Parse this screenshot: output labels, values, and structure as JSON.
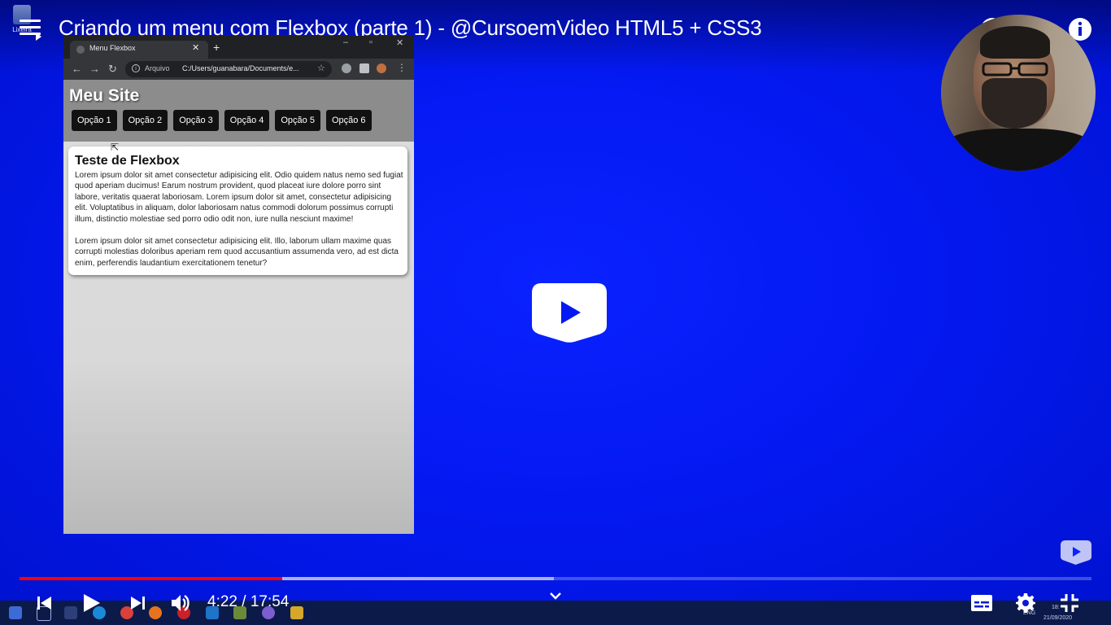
{
  "video": {
    "title": "Criando um menu com Flexbox (parte 1) - @CursoemVideo HTML5 + CSS3",
    "current_time": "4:22",
    "separator": " / ",
    "duration": "17:54",
    "played_fraction": 0.2447,
    "buffered_fraction": 0.4985
  },
  "desktop": {
    "recycle_bin_label": "Lixeira"
  },
  "browser": {
    "tab_title": "Menu Flexbox",
    "url_label": "Arquivo",
    "url": "C:/Users/guanabara/Documents/e..."
  },
  "site": {
    "title": "Meu Site",
    "menu": [
      "Opção 1",
      "Opção 2",
      "Opção 3",
      "Opção 4",
      "Opção 5",
      "Opção 6"
    ],
    "card": {
      "heading": "Teste de Flexbox",
      "p1": "Lorem ipsum dolor sit amet consectetur adipisicing elit. Odio quidem natus nemo sed fugiat quod aperiam ducimus! Earum nostrum provident, quod placeat iure dolore porro sint labore, veritatis quaerat laboriosam. Lorem ipsum dolor sit amet, consectetur adipisicing elit. Voluptatibus in aliquam, dolor laboriosam natus commodi dolorum possimus corrupti illum, distinctio molestiae sed porro odio odit non, iure nulla nesciunt maxime!",
      "p2": "Lorem ipsum dolor sit amet consectetur adipisicing elit. Illo, laborum ullam maxime quas corrupti molestias doloribus aperiam rem quod accusantium assumenda vero, ad est dicta enim, perferendis laudantium exercitationem tenetur?"
    }
  },
  "taskbar": {
    "date": "21/09/2020",
    "time_partial": "18:",
    "lang": "ENG"
  },
  "colors": {
    "progress_played": "#ff0000",
    "background": "#0419f2"
  },
  "icons": [
    "menu-icon",
    "clock-icon",
    "share-icon",
    "info-icon",
    "play-icon",
    "skip-previous-icon",
    "skip-next-icon",
    "volume-icon",
    "chevron-down-icon",
    "subtitles-icon",
    "gear-icon",
    "exit-fullscreen-icon"
  ]
}
